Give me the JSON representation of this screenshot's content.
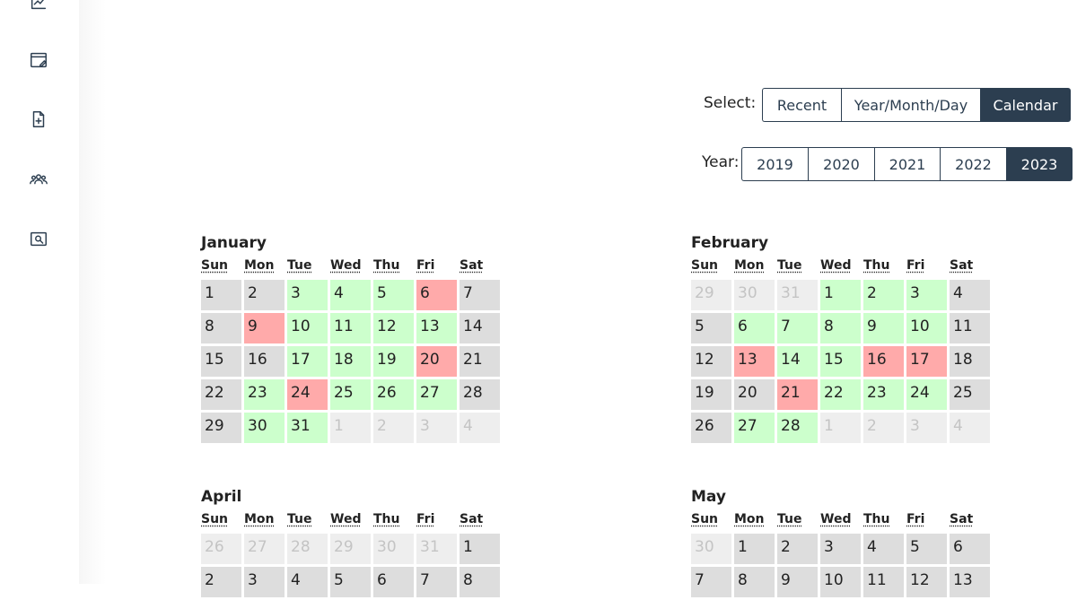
{
  "select": {
    "label": "Select:",
    "options": [
      "Recent",
      "Year/Month/Day",
      "Calendar"
    ],
    "active": 2
  },
  "year": {
    "label": "Year:",
    "options": [
      "2019",
      "2020",
      "2021",
      "2022",
      "2023"
    ],
    "active": 4
  },
  "dow": [
    "Sun",
    "Mon",
    "Tue",
    "Wed",
    "Thu",
    "Fri",
    "Sat"
  ],
  "colors": {
    "green": "#ccffcc",
    "red": "#ffaaaa",
    "gray": "#dddddd",
    "other": "#eeeeee",
    "accent": "#2c3e50"
  },
  "sidebar_icons": [
    "chart-icon",
    "edit-note-icon",
    "add-document-icon",
    "group-icon",
    "search-document-icon"
  ],
  "months": [
    {
      "name": "January",
      "weeks": [
        [
          {
            "d": "1",
            "s": "gray"
          },
          {
            "d": "2",
            "s": "gray"
          },
          {
            "d": "3",
            "s": "green"
          },
          {
            "d": "4",
            "s": "green"
          },
          {
            "d": "5",
            "s": "green"
          },
          {
            "d": "6",
            "s": "red"
          },
          {
            "d": "7",
            "s": "gray"
          }
        ],
        [
          {
            "d": "8",
            "s": "gray"
          },
          {
            "d": "9",
            "s": "red"
          },
          {
            "d": "10",
            "s": "green"
          },
          {
            "d": "11",
            "s": "green"
          },
          {
            "d": "12",
            "s": "green"
          },
          {
            "d": "13",
            "s": "green"
          },
          {
            "d": "14",
            "s": "gray"
          }
        ],
        [
          {
            "d": "15",
            "s": "gray"
          },
          {
            "d": "16",
            "s": "gray"
          },
          {
            "d": "17",
            "s": "green"
          },
          {
            "d": "18",
            "s": "green"
          },
          {
            "d": "19",
            "s": "green"
          },
          {
            "d": "20",
            "s": "red"
          },
          {
            "d": "21",
            "s": "gray"
          }
        ],
        [
          {
            "d": "22",
            "s": "gray"
          },
          {
            "d": "23",
            "s": "green"
          },
          {
            "d": "24",
            "s": "red"
          },
          {
            "d": "25",
            "s": "green"
          },
          {
            "d": "26",
            "s": "green"
          },
          {
            "d": "27",
            "s": "green"
          },
          {
            "d": "28",
            "s": "gray"
          }
        ],
        [
          {
            "d": "29",
            "s": "gray"
          },
          {
            "d": "30",
            "s": "green"
          },
          {
            "d": "31",
            "s": "green"
          },
          {
            "d": "1",
            "s": "other"
          },
          {
            "d": "2",
            "s": "other"
          },
          {
            "d": "3",
            "s": "other"
          },
          {
            "d": "4",
            "s": "other"
          }
        ]
      ]
    },
    {
      "name": "February",
      "weeks": [
        [
          {
            "d": "29",
            "s": "other"
          },
          {
            "d": "30",
            "s": "other"
          },
          {
            "d": "31",
            "s": "other"
          },
          {
            "d": "1",
            "s": "green"
          },
          {
            "d": "2",
            "s": "green"
          },
          {
            "d": "3",
            "s": "green"
          },
          {
            "d": "4",
            "s": "gray"
          }
        ],
        [
          {
            "d": "5",
            "s": "gray"
          },
          {
            "d": "6",
            "s": "green"
          },
          {
            "d": "7",
            "s": "green"
          },
          {
            "d": "8",
            "s": "green"
          },
          {
            "d": "9",
            "s": "green"
          },
          {
            "d": "10",
            "s": "green"
          },
          {
            "d": "11",
            "s": "gray"
          }
        ],
        [
          {
            "d": "12",
            "s": "gray"
          },
          {
            "d": "13",
            "s": "red"
          },
          {
            "d": "14",
            "s": "green"
          },
          {
            "d": "15",
            "s": "green"
          },
          {
            "d": "16",
            "s": "red"
          },
          {
            "d": "17",
            "s": "red"
          },
          {
            "d": "18",
            "s": "gray"
          }
        ],
        [
          {
            "d": "19",
            "s": "gray"
          },
          {
            "d": "20",
            "s": "gray"
          },
          {
            "d": "21",
            "s": "red"
          },
          {
            "d": "22",
            "s": "green"
          },
          {
            "d": "23",
            "s": "green"
          },
          {
            "d": "24",
            "s": "green"
          },
          {
            "d": "25",
            "s": "gray"
          }
        ],
        [
          {
            "d": "26",
            "s": "gray"
          },
          {
            "d": "27",
            "s": "green"
          },
          {
            "d": "28",
            "s": "green"
          },
          {
            "d": "1",
            "s": "other"
          },
          {
            "d": "2",
            "s": "other"
          },
          {
            "d": "3",
            "s": "other"
          },
          {
            "d": "4",
            "s": "other"
          }
        ]
      ]
    },
    {
      "name": "April",
      "weeks": [
        [
          {
            "d": "26",
            "s": "other"
          },
          {
            "d": "27",
            "s": "other"
          },
          {
            "d": "28",
            "s": "other"
          },
          {
            "d": "29",
            "s": "other"
          },
          {
            "d": "30",
            "s": "other"
          },
          {
            "d": "31",
            "s": "other"
          },
          {
            "d": "1",
            "s": "gray"
          }
        ],
        [
          {
            "d": "2",
            "s": "gray"
          },
          {
            "d": "3",
            "s": "gray"
          },
          {
            "d": "4",
            "s": "gray"
          },
          {
            "d": "5",
            "s": "gray"
          },
          {
            "d": "6",
            "s": "gray"
          },
          {
            "d": "7",
            "s": "gray"
          },
          {
            "d": "8",
            "s": "gray"
          }
        ]
      ]
    },
    {
      "name": "May",
      "weeks": [
        [
          {
            "d": "30",
            "s": "other"
          },
          {
            "d": "1",
            "s": "gray"
          },
          {
            "d": "2",
            "s": "gray"
          },
          {
            "d": "3",
            "s": "gray"
          },
          {
            "d": "4",
            "s": "gray"
          },
          {
            "d": "5",
            "s": "gray"
          },
          {
            "d": "6",
            "s": "gray"
          }
        ],
        [
          {
            "d": "7",
            "s": "gray"
          },
          {
            "d": "8",
            "s": "gray"
          },
          {
            "d": "9",
            "s": "gray"
          },
          {
            "d": "10",
            "s": "gray"
          },
          {
            "d": "11",
            "s": "gray"
          },
          {
            "d": "12",
            "s": "gray"
          },
          {
            "d": "13",
            "s": "gray"
          }
        ]
      ]
    }
  ]
}
